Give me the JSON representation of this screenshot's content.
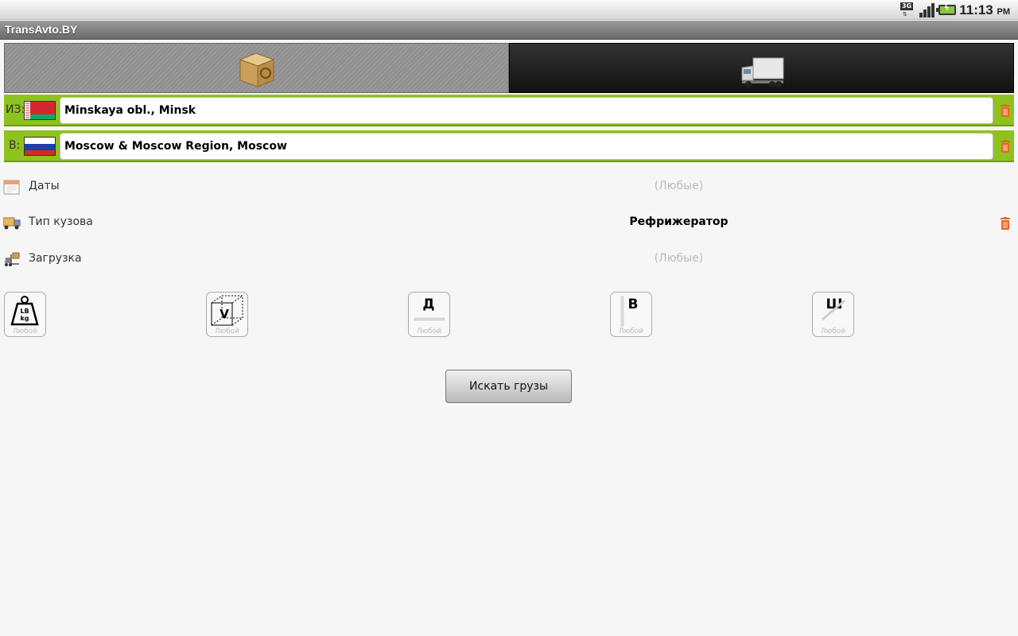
{
  "status": {
    "network": "3G",
    "time": "11:13",
    "ampm": "PM"
  },
  "app": {
    "title": "TransAvto.BY"
  },
  "route": {
    "from": {
      "prefix": "ИЗ:",
      "value": "Minskaya obl., Minsk"
    },
    "to": {
      "prefix": "В:",
      "value": "Moscow & Moscow Region, Moscow"
    }
  },
  "params": {
    "dates": {
      "label": "Даты",
      "value": "(Любые)"
    },
    "body_type": {
      "label": "Тип кузова",
      "value": "Рефрижератор"
    },
    "loading": {
      "label": "Загрузка",
      "value": "(Любые)"
    }
  },
  "filters": {
    "weight": {
      "caption": "Любой",
      "glyph": "LB kg"
    },
    "volume": {
      "caption": "Любой",
      "glyph": "V"
    },
    "length": {
      "caption": "Любой",
      "glyph": "Д"
    },
    "height": {
      "caption": "Любой",
      "glyph": "В"
    },
    "width": {
      "caption": "Любой",
      "glyph": "Ш"
    }
  },
  "search_button": {
    "label": "Искать грузы"
  },
  "colors": {
    "accent": "#8ec21e",
    "trash": "#e8671f"
  }
}
